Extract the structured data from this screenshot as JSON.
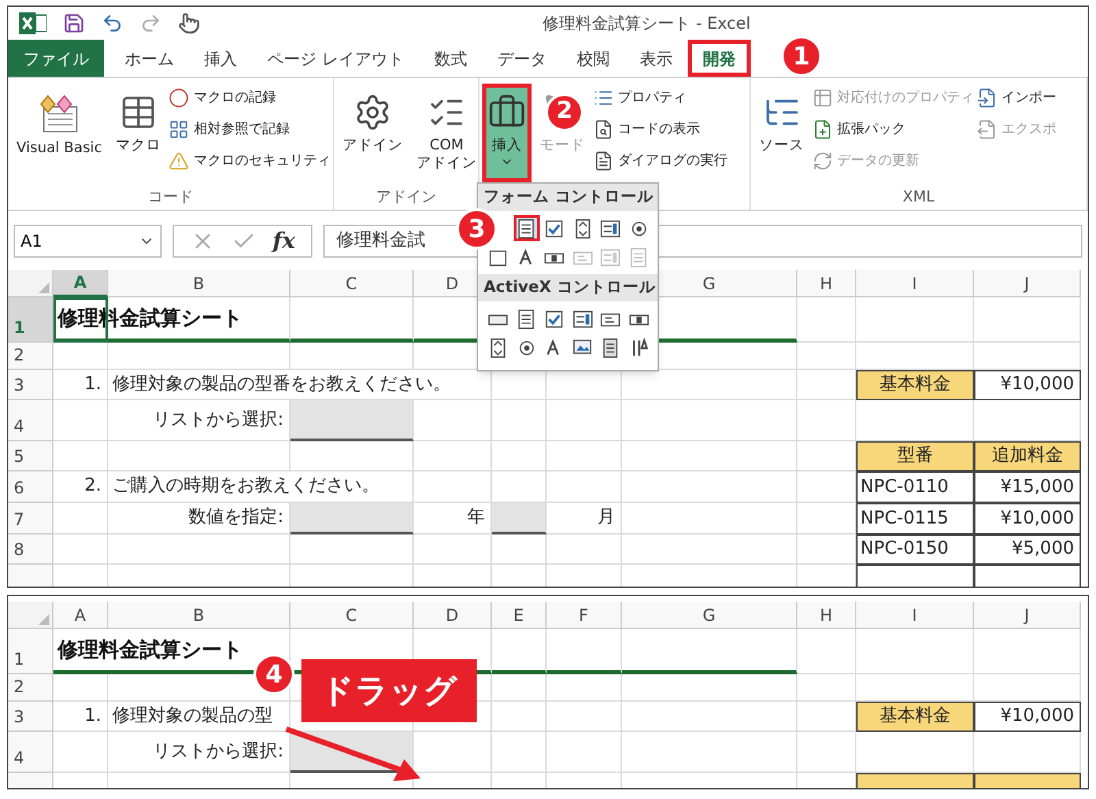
{
  "window": {
    "title": "修理料金試算シート - Excel"
  },
  "ribbon_tabs": [
    {
      "label": "ファイル",
      "kind": "file",
      "selected": false,
      "highlighted": false
    },
    {
      "label": "ホーム",
      "kind": "tab",
      "selected": false,
      "highlighted": false
    },
    {
      "label": "挿入",
      "kind": "tab",
      "selected": false,
      "highlighted": false
    },
    {
      "label": "ページ レイアウト",
      "kind": "tab",
      "selected": false,
      "highlighted": false
    },
    {
      "label": "数式",
      "kind": "tab",
      "selected": false,
      "highlighted": false
    },
    {
      "label": "データ",
      "kind": "tab",
      "selected": false,
      "highlighted": false
    },
    {
      "label": "校閲",
      "kind": "tab",
      "selected": false,
      "highlighted": false
    },
    {
      "label": "表示",
      "kind": "tab",
      "selected": false,
      "highlighted": false
    },
    {
      "label": "開発",
      "kind": "tab",
      "selected": true,
      "highlighted": true
    }
  ],
  "ribbon_groups": [
    {
      "label": "コード",
      "buttons": [
        {
          "kind": "large",
          "label": "Visual Basic",
          "disabled": false,
          "pressed": false,
          "highlighted": false,
          "menu": false
        },
        {
          "kind": "large",
          "label": "マクロ",
          "disabled": false,
          "pressed": false,
          "highlighted": false,
          "menu": false
        },
        {
          "kind": "small",
          "label": "マクロの記録",
          "disabled": false
        },
        {
          "kind": "small",
          "label": "相対参照で記録",
          "disabled": false
        },
        {
          "kind": "small",
          "label": "マクロのセキュリティ",
          "disabled": false
        }
      ]
    },
    {
      "label": "アドイン",
      "buttons": [
        {
          "kind": "large",
          "label": "アドイン",
          "disabled": false,
          "pressed": false,
          "highlighted": false,
          "menu": false
        },
        {
          "kind": "large",
          "label": "COM\nアドイン",
          "disabled": false,
          "pressed": false,
          "highlighted": false,
          "menu": false
        }
      ]
    },
    {
      "buttons": [
        {
          "kind": "large",
          "label": "挿入",
          "disabled": false,
          "pressed": true,
          "highlighted": true,
          "menu": true
        },
        {
          "kind": "large",
          "label": "モード",
          "disabled": true,
          "pressed": false,
          "highlighted": false,
          "menu": false
        },
        {
          "kind": "small",
          "label": "プロパティ",
          "disabled": false
        },
        {
          "kind": "small",
          "label": "コードの表示",
          "disabled": false
        },
        {
          "kind": "small",
          "label": "ダイアログの実行",
          "disabled": false
        }
      ]
    },
    {
      "label": "XML",
      "buttons": [
        {
          "kind": "large",
          "label": "ソース",
          "disabled": false,
          "pressed": false,
          "highlighted": false,
          "menu": false
        },
        {
          "kind": "small",
          "label": "対応付けのプロパティ",
          "disabled": true
        },
        {
          "kind": "small",
          "label": "拡張パック",
          "disabled": false
        },
        {
          "kind": "small",
          "label": "データの更新",
          "disabled": true
        },
        {
          "kind": "small",
          "label": "インポー",
          "disabled": false
        },
        {
          "kind": "small",
          "label": "エクスポ",
          "disabled": true
        }
      ]
    }
  ],
  "formula_bar": {
    "name_box": "A1",
    "function_label": "fx",
    "formula": "修理料金試"
  },
  "control_menu": {
    "sections": [
      {
        "title": "フォーム コントロール",
        "items": [
          {
            "kind": "combo",
            "highlighted": true,
            "disabled": false
          },
          {
            "kind": "checkbox",
            "highlighted": false,
            "disabled": false
          },
          {
            "kind": "spin",
            "highlighted": false,
            "disabled": false
          },
          {
            "kind": "listbox",
            "highlighted": false,
            "disabled": false
          },
          {
            "kind": "option",
            "highlighted": false,
            "disabled": false
          },
          {
            "kind": "groupbox",
            "highlighted": false,
            "disabled": false
          },
          {
            "kind": "label",
            "highlighted": false,
            "disabled": false
          },
          {
            "kind": "scrollbar",
            "highlighted": false,
            "disabled": false
          },
          {
            "kind": "textfield",
            "highlighted": false,
            "disabled": true
          },
          {
            "kind": "listbox",
            "highlighted": false,
            "disabled": true
          },
          {
            "kind": "combo",
            "highlighted": false,
            "disabled": true
          }
        ]
      },
      {
        "title": "ActiveX コントロール",
        "items": [
          {
            "kind": "button",
            "highlighted": false,
            "disabled": false
          },
          {
            "kind": "combo",
            "highlighted": false,
            "disabled": false
          },
          {
            "kind": "checkbox",
            "highlighted": false,
            "disabled": false
          },
          {
            "kind": "listbox",
            "highlighted": false,
            "disabled": false
          },
          {
            "kind": "textfield",
            "highlighted": false,
            "disabled": false
          },
          {
            "kind": "scrollbar",
            "highlighted": false,
            "disabled": false
          },
          {
            "kind": "spin",
            "highlighted": false,
            "disabled": false
          },
          {
            "kind": "option",
            "highlighted": false,
            "disabled": false
          },
          {
            "kind": "label",
            "highlighted": false,
            "disabled": false
          },
          {
            "kind": "image",
            "highlighted": false,
            "disabled": false
          },
          {
            "kind": "toggle",
            "highlighted": false,
            "disabled": false
          },
          {
            "kind": "tools",
            "highlighted": false,
            "disabled": false
          }
        ]
      }
    ]
  },
  "callouts": [
    {
      "number": "1"
    },
    {
      "number": "2"
    },
    {
      "number": "3"
    }
  ],
  "sheets": [
    {
      "columns": [
        {
          "label": "A",
          "selected": true
        },
        {
          "label": "B",
          "selected": false
        },
        {
          "label": "C",
          "selected": false
        },
        {
          "label": "D",
          "selected": false
        },
        null,
        null,
        {
          "label": "G",
          "selected": false
        },
        {
          "label": "H",
          "selected": false
        },
        {
          "label": "I",
          "selected": false
        },
        {
          "label": "J",
          "selected": false
        }
      ],
      "rows": [
        {
          "label": "1",
          "selected": true,
          "rule": true,
          "cells": [
            {
              "kind": "title",
              "text": "修理料金試算シート",
              "selected": true
            },
            null,
            null,
            null,
            null,
            null,
            null,
            null,
            null,
            null
          ]
        },
        {
          "label": "2",
          "selected": false,
          "rule": false,
          "cells": [
            null,
            null,
            null,
            null,
            null,
            null,
            null,
            null,
            null,
            null
          ]
        },
        {
          "label": "3",
          "selected": false,
          "rule": false,
          "cells": [
            {
              "kind": "label",
              "text": "1."
            },
            {
              "kind": "question",
              "text": "修理対象の製品の型番をお教えください。"
            },
            null,
            null,
            null,
            null,
            null,
            null,
            {
              "kind": "header",
              "text": "基本料金"
            },
            {
              "kind": "value",
              "text": "¥10,000"
            }
          ]
        },
        {
          "label": "4",
          "selected": false,
          "rule": false,
          "cells": [
            null,
            {
              "kind": "label",
              "text": "リストから選択:"
            },
            {
              "kind": "input"
            },
            null,
            null,
            null,
            null,
            null,
            null,
            null
          ]
        },
        {
          "label": "5",
          "selected": false,
          "rule": false,
          "cells": [
            null,
            null,
            null,
            null,
            null,
            null,
            null,
            null,
            {
              "kind": "header",
              "text": "型番"
            },
            {
              "kind": "header",
              "text": "追加料金"
            }
          ]
        },
        {
          "label": "6",
          "selected": false,
          "rule": false,
          "cells": [
            {
              "kind": "label",
              "text": "2."
            },
            {
              "kind": "question",
              "text": "ご購入の時期をお教えください。"
            },
            null,
            null,
            null,
            null,
            null,
            null,
            {
              "kind": "code",
              "text": "NPC-0110"
            },
            {
              "kind": "value",
              "text": "¥15,000"
            }
          ]
        },
        {
          "label": "7",
          "selected": false,
          "rule": false,
          "cells": [
            null,
            {
              "kind": "label",
              "text": "数値を指定:"
            },
            {
              "kind": "input"
            },
            {
              "kind": "label",
              "text": "年"
            },
            {
              "kind": "input"
            },
            {
              "kind": "label",
              "text": "月"
            },
            null,
            null,
            {
              "kind": "code",
              "text": "NPC-0115"
            },
            {
              "kind": "value",
              "text": "¥10,000"
            }
          ]
        },
        {
          "label": "8",
          "selected": false,
          "rule": false,
          "cells": [
            null,
            null,
            null,
            null,
            null,
            null,
            null,
            null,
            {
              "kind": "code",
              "text": "NPC-0150"
            },
            {
              "kind": "value",
              "text": "¥5,000"
            }
          ]
        },
        {
          "selected": false,
          "cells": [
            null,
            null,
            null,
            null,
            null,
            null,
            null,
            null,
            {
              "kind": "code"
            },
            {
              "kind": "value"
            }
          ]
        }
      ]
    },
    {
      "columns": [
        {
          "label": "A",
          "selected": false
        },
        {
          "label": "B",
          "selected": false
        },
        {
          "label": "C",
          "selected": false
        },
        {
          "label": "D",
          "selected": false
        },
        {
          "label": "E",
          "selected": false
        },
        {
          "label": "F",
          "selected": false
        },
        {
          "label": "G",
          "selected": false
        },
        {
          "label": "H",
          "selected": false
        },
        {
          "label": "I",
          "selected": false
        },
        {
          "label": "J",
          "selected": false
        }
      ],
      "rows": [
        {
          "label": "1",
          "selected": false,
          "rule": true,
          "cells": [
            {
              "kind": "title",
              "text": "修理料金試算シート",
              "selected": false
            },
            null,
            null,
            null,
            null,
            null,
            null,
            null,
            null,
            null
          ]
        },
        {
          "label": "2",
          "selected": false,
          "rule": false,
          "cells": [
            null,
            null,
            null,
            null,
            null,
            null,
            null,
            null,
            null,
            null
          ]
        },
        {
          "label": "3",
          "selected": false,
          "rule": false,
          "cells": [
            {
              "kind": "label",
              "text": "1."
            },
            {
              "kind": "question",
              "text": "修理対象の製品の型"
            },
            null,
            null,
            null,
            null,
            null,
            null,
            {
              "kind": "header",
              "text": "基本料金"
            },
            {
              "kind": "value",
              "text": "¥10,000"
            }
          ]
        },
        {
          "label": "4",
          "selected": false,
          "rule": false,
          "cells": [
            null,
            {
              "kind": "label",
              "text": "リストから選択:"
            },
            {
              "kind": "input"
            },
            null,
            null,
            null,
            null,
            null,
            null,
            null
          ]
        },
        {
          "selected": false,
          "cells": [
            null,
            null,
            null,
            null,
            null,
            null,
            null,
            null,
            {
              "kind": "header"
            },
            {
              "kind": "header"
            }
          ]
        }
      ]
    }
  ],
  "drag_callout": {
    "number": "4",
    "label": "ドラッグ"
  }
}
